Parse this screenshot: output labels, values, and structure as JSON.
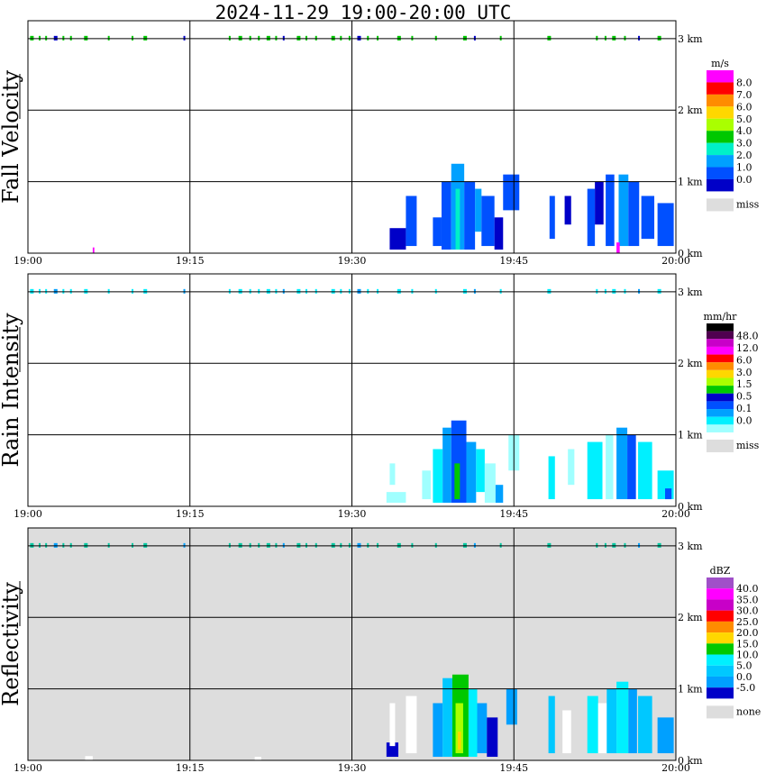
{
  "title": "2024-11-29   19:00-20:00 UTC",
  "x_tick_labels": [
    "19:00",
    "19:15",
    "19:30",
    "19:45",
    "20:00"
  ],
  "height_tick_labels": [
    "0 km",
    "1 km",
    "2 km",
    "3 km"
  ],
  "panel_background": {
    "Fall Velocity": "#ffffff",
    "Rain Intensity": "#ffffff",
    "Reflectivity": "#dddddd"
  },
  "chart_data": [
    {
      "type": "heatmap",
      "ylabel": "Fall Velocity",
      "unit": "m/s",
      "missing_label": "miss",
      "x_ticks": [
        "19:00",
        "19:15",
        "19:30",
        "19:45",
        "20:00"
      ],
      "xlim_min": [
        0,
        60
      ],
      "ylim_km": [
        0,
        3.25
      ],
      "legend_labels": [
        "8.0",
        "7.0",
        "6.0",
        "5.0",
        "4.0",
        "3.0",
        "2.0",
        "1.0",
        "0.0"
      ],
      "legend_colors": [
        "#ff00ff",
        "#ff0000",
        "#ff8c00",
        "#ffd700",
        "#aaff00",
        "#00c800",
        "#00f0c8",
        "#00a0ff",
        "#0050ff",
        "#0000c8"
      ],
      "missing_color": "#dddddd",
      "echoes": [
        {
          "t": [
            33.5,
            35.0
          ],
          "h": [
            0.05,
            0.35
          ],
          "color": "#0000c8"
        },
        {
          "t": [
            35.0,
            36.0
          ],
          "h": [
            0.1,
            0.8
          ],
          "color": "#0050ff"
        },
        {
          "t": [
            37.5,
            38.3
          ],
          "h": [
            0.1,
            0.5
          ],
          "color": "#0050ff"
        },
        {
          "t": [
            38.3,
            39.2
          ],
          "h": [
            0.05,
            1.0
          ],
          "color": "#0050ff"
        },
        {
          "t": [
            39.2,
            40.4
          ],
          "h": [
            0.05,
            1.25
          ],
          "color": "#00a0ff"
        },
        {
          "t": [
            39.6,
            40.0
          ],
          "h": [
            0.05,
            0.9
          ],
          "color": "#00f0c8"
        },
        {
          "t": [
            40.4,
            41.4
          ],
          "h": [
            0.05,
            1.0
          ],
          "color": "#0050ff"
        },
        {
          "t": [
            41.4,
            42.0
          ],
          "h": [
            0.3,
            0.9
          ],
          "color": "#00a0ff"
        },
        {
          "t": [
            42.0,
            43.2
          ],
          "h": [
            0.1,
            0.8
          ],
          "color": "#0050ff"
        },
        {
          "t": [
            43.2,
            44.0
          ],
          "h": [
            0.05,
            0.5
          ],
          "color": "#0000c8"
        },
        {
          "t": [
            44.0,
            45.5
          ],
          "h": [
            0.6,
            1.1
          ],
          "color": "#0050ff"
        },
        {
          "t": [
            48.3,
            48.8
          ],
          "h": [
            0.2,
            0.8
          ],
          "color": "#0050ff"
        },
        {
          "t": [
            49.7,
            50.3
          ],
          "h": [
            0.4,
            0.8
          ],
          "color": "#0000c8"
        },
        {
          "t": [
            51.8,
            52.5
          ],
          "h": [
            0.1,
            0.9
          ],
          "color": "#0050ff"
        },
        {
          "t": [
            52.5,
            53.3
          ],
          "h": [
            0.4,
            1.0
          ],
          "color": "#0000c8"
        },
        {
          "t": [
            53.5,
            54.3
          ],
          "h": [
            0.1,
            1.1
          ],
          "color": "#0050ff"
        },
        {
          "t": [
            54.7,
            55.6
          ],
          "h": [
            0.1,
            1.1
          ],
          "color": "#00a0ff"
        },
        {
          "t": [
            55.6,
            56.6
          ],
          "h": [
            0.1,
            1.0
          ],
          "color": "#0050ff"
        },
        {
          "t": [
            56.8,
            58.0
          ],
          "h": [
            0.2,
            0.8
          ],
          "color": "#0050ff"
        },
        {
          "t": [
            58.3,
            59.8
          ],
          "h": [
            0.1,
            0.7
          ],
          "color": "#0050ff"
        },
        {
          "t": [
            54.5,
            54.8
          ],
          "h": [
            0.0,
            0.15
          ],
          "color": "#ff00ff"
        },
        {
          "t": [
            6.0,
            6.15
          ],
          "h": [
            0.0,
            0.08
          ],
          "color": "#ff00ff"
        }
      ],
      "top_layer": {
        "h": 3.0,
        "color": "#00c800",
        "dark_color": "#0000c8",
        "t": [
          0.2,
          1.0,
          1.6,
          2.4,
          3.2,
          3.9,
          5.2,
          7.4,
          9.6,
          10.7,
          14.4,
          18.6,
          19.5,
          20.5,
          21.3,
          22.1,
          22.9,
          23.6,
          24.9,
          25.7,
          26.6,
          28.1,
          28.9,
          29.7,
          30.5,
          31.4,
          32.3,
          34.2,
          35.5,
          37.7,
          40.3,
          41.3,
          43.7,
          48.1,
          52.6,
          53.4,
          54.1,
          55.2,
          56.5,
          58.3
        ]
      }
    },
    {
      "type": "heatmap",
      "ylabel": "Rain Intensity",
      "unit": "mm/hr",
      "missing_label": "miss",
      "x_ticks": [
        "19:00",
        "19:15",
        "19:30",
        "19:45",
        "20:00"
      ],
      "xlim_min": [
        0,
        60
      ],
      "ylim_km": [
        0,
        3.25
      ],
      "legend_labels": [
        "48.0",
        "12.0",
        "6.0",
        "3.0",
        "1.5",
        "0.5",
        "0.1",
        "0.0"
      ],
      "legend_colors": [
        "#000000",
        "#500050",
        "#c800c8",
        "#ff00ff",
        "#ff0000",
        "#ff8c00",
        "#ffd700",
        "#aaff00",
        "#00c800",
        "#0000c8",
        "#0050ff",
        "#00a0ff",
        "#00f0ff",
        "#a0ffff"
      ],
      "missing_color": "#dddddd",
      "echoes": [
        {
          "t": [
            33.2,
            35.0
          ],
          "h": [
            0.05,
            0.2
          ],
          "color": "#a0ffff"
        },
        {
          "t": [
            33.5,
            34.0
          ],
          "h": [
            0.3,
            0.6
          ],
          "color": "#a0ffff"
        },
        {
          "t": [
            36.5,
            37.3
          ],
          "h": [
            0.1,
            0.5
          ],
          "color": "#a0ffff"
        },
        {
          "t": [
            37.5,
            38.4
          ],
          "h": [
            0.05,
            0.8
          ],
          "color": "#00f0ff"
        },
        {
          "t": [
            38.4,
            39.2
          ],
          "h": [
            0.05,
            1.1
          ],
          "color": "#00a0ff"
        },
        {
          "t": [
            39.2,
            40.6
          ],
          "h": [
            0.05,
            1.2
          ],
          "color": "#0050ff"
        },
        {
          "t": [
            39.5,
            40.0
          ],
          "h": [
            0.1,
            0.6
          ],
          "color": "#00c800"
        },
        {
          "t": [
            40.6,
            41.5
          ],
          "h": [
            0.05,
            0.9
          ],
          "color": "#00a0ff"
        },
        {
          "t": [
            41.5,
            42.3
          ],
          "h": [
            0.2,
            0.8
          ],
          "color": "#00f0ff"
        },
        {
          "t": [
            42.3,
            43.3
          ],
          "h": [
            0.05,
            0.6
          ],
          "color": "#a0ffff"
        },
        {
          "t": [
            43.3,
            44.0
          ],
          "h": [
            0.05,
            0.3
          ],
          "color": "#00a0ff"
        },
        {
          "t": [
            44.5,
            45.5
          ],
          "h": [
            0.5,
            1.0
          ],
          "color": "#a0ffff"
        },
        {
          "t": [
            48.2,
            48.8
          ],
          "h": [
            0.1,
            0.7
          ],
          "color": "#00f0ff"
        },
        {
          "t": [
            50.0,
            50.6
          ],
          "h": [
            0.3,
            0.8
          ],
          "color": "#a0ffff"
        },
        {
          "t": [
            51.8,
            53.2
          ],
          "h": [
            0.1,
            0.9
          ],
          "color": "#00f0ff"
        },
        {
          "t": [
            53.5,
            54.2
          ],
          "h": [
            0.1,
            1.0
          ],
          "color": "#a0ffff"
        },
        {
          "t": [
            54.5,
            55.5
          ],
          "h": [
            0.1,
            1.1
          ],
          "color": "#00a0ff"
        },
        {
          "t": [
            55.5,
            56.3
          ],
          "h": [
            0.1,
            1.0
          ],
          "color": "#0050ff"
        },
        {
          "t": [
            56.5,
            57.8
          ],
          "h": [
            0.1,
            0.9
          ],
          "color": "#00f0ff"
        },
        {
          "t": [
            58.3,
            59.8
          ],
          "h": [
            0.1,
            0.5
          ],
          "color": "#00f0ff"
        },
        {
          "t": [
            59.0,
            59.6
          ],
          "h": [
            0.1,
            0.25
          ],
          "color": "#0050ff"
        }
      ],
      "top_layer": {
        "h": 3.0,
        "color": "#00f0ff",
        "dark_color": "#00a0ff",
        "t": [
          0.2,
          1.0,
          1.6,
          2.4,
          3.2,
          3.9,
          5.2,
          7.4,
          9.6,
          10.7,
          14.4,
          18.6,
          19.5,
          20.5,
          21.3,
          22.1,
          22.9,
          23.6,
          24.9,
          25.7,
          26.6,
          28.1,
          28.9,
          29.7,
          30.5,
          31.4,
          32.3,
          34.2,
          35.5,
          37.7,
          40.3,
          41.3,
          43.7,
          48.1,
          52.6,
          53.4,
          54.1,
          55.2,
          56.5,
          58.3
        ]
      }
    },
    {
      "type": "heatmap",
      "ylabel": "Reflectivity",
      "unit": "dBZ",
      "missing_label": "none",
      "x_ticks": [
        "19:00",
        "19:15",
        "19:30",
        "19:45",
        "20:00"
      ],
      "xlim_min": [
        0,
        60
      ],
      "ylim_km": [
        0,
        3.25
      ],
      "legend_labels": [
        "40.0",
        "35.0",
        "30.0",
        "25.0",
        "20.0",
        "15.0",
        "10.0",
        "5.0",
        "0.0",
        "-5.0"
      ],
      "legend_colors": [
        "#a050c8",
        "#ff00ff",
        "#c800c8",
        "#ff0000",
        "#ff8c00",
        "#ffd700",
        "#00c800",
        "#00f0ff",
        "#00c8ff",
        "#00a0ff",
        "#0000c8"
      ],
      "missing_color": "#dddddd",
      "echoes": [
        {
          "t": [
            33.2,
            34.3
          ],
          "h": [
            0.05,
            0.25
          ],
          "color": "#0000c8"
        },
        {
          "t": [
            33.5,
            34.0
          ],
          "h": [
            0.2,
            0.8
          ],
          "color": "#ffffff"
        },
        {
          "t": [
            35.0,
            36.0
          ],
          "h": [
            0.1,
            0.9
          ],
          "color": "#ffffff"
        },
        {
          "t": [
            37.5,
            38.4
          ],
          "h": [
            0.05,
            0.8
          ],
          "color": "#00a0ff"
        },
        {
          "t": [
            38.4,
            39.3
          ],
          "h": [
            0.05,
            1.15
          ],
          "color": "#00c8ff"
        },
        {
          "t": [
            39.3,
            40.8
          ],
          "h": [
            0.05,
            1.2
          ],
          "color": "#00c800"
        },
        {
          "t": [
            39.6,
            40.3
          ],
          "h": [
            0.1,
            0.8
          ],
          "color": "#aaff00"
        },
        {
          "t": [
            39.8,
            40.1
          ],
          "h": [
            0.15,
            0.4
          ],
          "color": "#ffd700"
        },
        {
          "t": [
            40.8,
            41.6
          ],
          "h": [
            0.05,
            1.0
          ],
          "color": "#00f0ff"
        },
        {
          "t": [
            41.6,
            42.5
          ],
          "h": [
            0.1,
            0.8
          ],
          "color": "#00a0ff"
        },
        {
          "t": [
            42.5,
            43.5
          ],
          "h": [
            0.05,
            0.6
          ],
          "color": "#0000c8"
        },
        {
          "t": [
            44.3,
            45.3
          ],
          "h": [
            0.5,
            1.0
          ],
          "color": "#00a0ff"
        },
        {
          "t": [
            48.2,
            48.8
          ],
          "h": [
            0.1,
            0.9
          ],
          "color": "#00c8ff"
        },
        {
          "t": [
            49.5,
            50.3
          ],
          "h": [
            0.1,
            0.7
          ],
          "color": "#ffffff"
        },
        {
          "t": [
            51.8,
            52.8
          ],
          "h": [
            0.1,
            0.9
          ],
          "color": "#00f0ff"
        },
        {
          "t": [
            52.8,
            53.6
          ],
          "h": [
            0.1,
            0.8
          ],
          "color": "#ffffff"
        },
        {
          "t": [
            53.6,
            54.5
          ],
          "h": [
            0.1,
            1.0
          ],
          "color": "#00c8ff"
        },
        {
          "t": [
            54.5,
            55.6
          ],
          "h": [
            0.1,
            1.1
          ],
          "color": "#00f0ff"
        },
        {
          "t": [
            55.6,
            56.4
          ],
          "h": [
            0.1,
            1.0
          ],
          "color": "#00a0ff"
        },
        {
          "t": [
            56.5,
            57.8
          ],
          "h": [
            0.1,
            0.9
          ],
          "color": "#00c8ff"
        },
        {
          "t": [
            58.3,
            59.8
          ],
          "h": [
            0.1,
            0.6
          ],
          "color": "#00a0ff"
        },
        {
          "t": [
            5.3,
            6.0
          ],
          "h": [
            0.0,
            0.06
          ],
          "color": "#ffffff"
        },
        {
          "t": [
            21.0,
            21.6
          ],
          "h": [
            0.0,
            0.05
          ],
          "color": "#ffffff"
        }
      ],
      "top_layer": {
        "h": 3.0,
        "color": "#00c8a0",
        "dark_color": "#00a0ff",
        "t": [
          0.2,
          1.0,
          1.6,
          2.4,
          3.2,
          3.9,
          5.2,
          7.4,
          9.6,
          10.7,
          14.4,
          18.6,
          19.5,
          20.5,
          21.3,
          22.1,
          22.9,
          23.6,
          24.9,
          25.7,
          26.6,
          28.1,
          28.9,
          29.7,
          30.5,
          31.4,
          32.3,
          34.2,
          35.5,
          37.7,
          40.3,
          41.3,
          43.7,
          48.1,
          52.6,
          53.4,
          54.1,
          55.2,
          56.5,
          58.3
        ]
      }
    }
  ]
}
